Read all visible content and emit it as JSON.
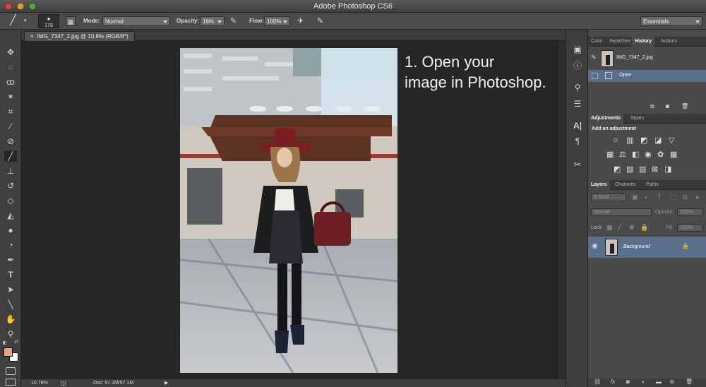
{
  "window": {
    "title": "Adobe Photoshop CS6"
  },
  "options_bar": {
    "brush_size": "178",
    "mode_label": "Mode:",
    "mode_value": "Normal",
    "opacity_label": "Opacity:",
    "opacity_value": "16%",
    "flow_label": "Flow:",
    "flow_value": "100%",
    "workspace": "Essentials"
  },
  "document": {
    "tab_title": "IMG_7347_2.jpg @ 10.8% (RGB/8*)"
  },
  "caption": {
    "line1": "1. Open your",
    "line2": "image in Photoshop."
  },
  "status": {
    "zoom": "10.78%",
    "doc_size": "Doc: 57.1M/57.1M"
  },
  "history_panel": {
    "tabs": [
      "Color",
      "Swatches",
      "History",
      "Actions"
    ],
    "snapshot_name": "IMG_7347_2.jpg",
    "steps": [
      "Open"
    ]
  },
  "adjustments_panel": {
    "tabs": [
      "Adjustments",
      "Styles"
    ],
    "heading": "Add an adjustment"
  },
  "layers_panel": {
    "tabs": [
      "Layers",
      "Channels",
      "Paths"
    ],
    "kind_filter": "Kind",
    "blend_mode": "Normal",
    "opacity_label": "Opacity:",
    "opacity_value": "100%",
    "lock_label": "Lock:",
    "fill_label": "Fill:",
    "fill_value": "100%",
    "layers": [
      {
        "name": "Background"
      }
    ]
  },
  "colors": {
    "foreground": "#e7a676",
    "background": "#ffffff",
    "selection": "#5a6f8c"
  }
}
